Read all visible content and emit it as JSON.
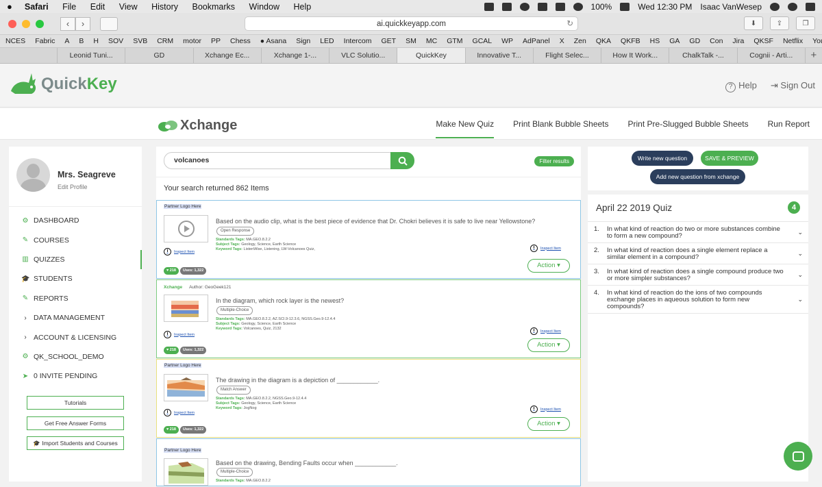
{
  "mac_menu": {
    "app": "Safari",
    "items": [
      "File",
      "Edit",
      "View",
      "History",
      "Bookmarks",
      "Window",
      "Help"
    ],
    "battery": "100%",
    "clock": "Wed 12:30 PM",
    "user": "Isaac VanWesep"
  },
  "browser": {
    "url": "ai.quickkeyapp.com",
    "bookmarks": [
      "NCES",
      "Fabric",
      "A",
      "B",
      "H",
      "SOV",
      "SVB",
      "CRM",
      "motor",
      "PP",
      "Chess",
      "● Asana",
      "Sign",
      "LED",
      "Intercom",
      "GET",
      "SM",
      "MC",
      "GTM",
      "GCAL",
      "WP",
      "AdPanel",
      "X",
      "Zen",
      "QKA",
      "QKFB",
      "HS",
      "GA",
      "GD",
      "Con",
      "Jira",
      "QKSF",
      "Netflix",
      "YouTube"
    ],
    "tabs": [
      "Leonid Tuni...",
      "GD",
      "Xchange Ec...",
      "Xchange 1-...",
      "VLC Solutio...",
      "QuickKey",
      "Innovative T...",
      "Flight Selec...",
      "How It Work...",
      "ChalkTalk -...",
      "Cognii - Arti..."
    ],
    "active_tab": "QuickKey"
  },
  "header": {
    "logo_quick": "Quick",
    "logo_key": "Key",
    "help": "Help",
    "sign_out": "Sign Out"
  },
  "subnav": {
    "logo": "Xchange",
    "links": [
      "Make New Quiz",
      "Print Blank Bubble Sheets",
      "Print Pre-Slugged Bubble Sheets",
      "Run Report"
    ]
  },
  "profile": {
    "name": "Mrs. Seagreve",
    "edit": "Edit Profile"
  },
  "menu": [
    {
      "label": "DASHBOARD",
      "icon": "⚙"
    },
    {
      "label": "COURSES",
      "icon": "✎"
    },
    {
      "label": "QUIZZES",
      "icon": "▥"
    },
    {
      "label": "STUDENTS",
      "icon": "🎓"
    },
    {
      "label": "REPORTS",
      "icon": "✎"
    },
    {
      "label": "DATA MANAGEMENT",
      "icon": "›"
    },
    {
      "label": "ACCOUNT & LICENSING",
      "icon": "›"
    },
    {
      "label": "QK_SCHOOL_DEMO",
      "icon": "⚙"
    },
    {
      "label": "0 INVITE PENDING",
      "icon": "➤"
    }
  ],
  "left_buttons": [
    "Tutorials",
    "Get Free Answer Forms",
    "Import Students and Courses"
  ],
  "search": {
    "query": "volcanoes",
    "filter": "Filter results",
    "results": "Your search returned 862 Items"
  },
  "cards": [
    {
      "header": "Partner Logo Here",
      "question": "Based on the audio clip, what is the best piece of evidence that Dr. Chokri believes it is safe to live near Yellowstone?",
      "type": "Open Response",
      "standards": "MA.GEO.8.2.2",
      "subjects": "Geology, Science, Earth Science",
      "keywords": "ListenWise, Listening, LW-Volcanoes Quiz,",
      "likes": "♥ 218",
      "uses": "Uses: 1,322"
    },
    {
      "header": "Xchange",
      "author": "Author: GeoGeek121",
      "question": "In the diagram, which rock layer is the newest?",
      "type": "Multiple-Choice",
      "standards": "MA.GEO.8.2.2, AZ.SCI.9-12.3.6, NGSS.Geo.9-12.4.4",
      "subjects": "Geology, Science, Earth Science",
      "keywords": "Volcanoes, Quiz, 2132",
      "likes": "♥ 218",
      "uses": "Uses: 1,322"
    },
    {
      "header": "Partner Logo Here",
      "question": "The drawing in the diagram is a depiction of ____________.",
      "type": "Match Answer",
      "standards": "MA.GEO.8.2.2, NGSS.Geo.9-12.4.4",
      "subjects": "Geology, Science, Earth Science",
      "keywords": "JogNog",
      "likes": "♥ 218",
      "uses": "Uses: 1,322"
    },
    {
      "header": "Partner Logo Here",
      "question": "Based on the drawing, Bending Faults occur when ____________.",
      "type": "Multiple-Choice",
      "standards": "MA.GEO.8.2.2"
    }
  ],
  "labels": {
    "inspect": "Inspect Item",
    "action": "Action ▾",
    "standards_tag": "Standards Tags:",
    "subject_tag": "Subject Tags:",
    "keyword_tag": "Keyword Tags:"
  },
  "right_panel": {
    "write_new": "Write new question",
    "save_preview": "SAVE & PREVIEW",
    "add_from_xchange": "Add new question from xchange",
    "quiz_title": "April 22 2019 Quiz",
    "quiz_count": "4",
    "questions": [
      "In what kind of reaction do two or more substances combine to form a new compound?",
      "In what kind of reaction does a single element replace a similar element in a compound?",
      "In what kind of reaction does a single compound produce two or more simpler substances?",
      "In what kind of reaction do the ions of two compounds exchange places in aqueous solution to form new compounds?"
    ]
  },
  "colors": {
    "brand_green": "#4caf50",
    "navy": "#2b3e5c"
  }
}
